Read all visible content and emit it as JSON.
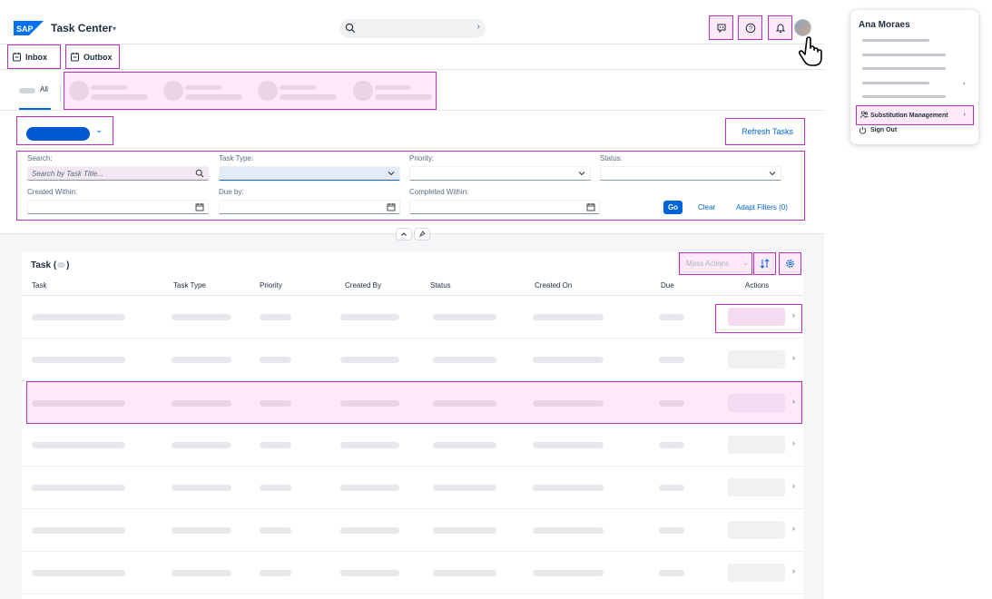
{
  "shell": {
    "logo_text": "SAP",
    "title": "Task Center",
    "search_placeholder": "",
    "brand_color": "#0064d9"
  },
  "subnav": {
    "inbox": "Inbox",
    "outbox": "Outbox"
  },
  "tabs": {
    "all": "All"
  },
  "filters": {
    "refresh": "Refresh Tasks",
    "search_label": "Search:",
    "search_placeholder": "Search by Task Title...",
    "task_type_label": "Task Type:",
    "priority_label": "Priority:",
    "status_label": "Status:",
    "created_within_label": "Created Within:",
    "due_by_label": "Due by:",
    "completed_within_label": "Completed Within:",
    "go": "Go",
    "clear": "Clear",
    "adapt": "Adapt Filters (0)"
  },
  "table": {
    "title_prefix": "Task (",
    "title_suffix": ")",
    "mass_actions": "Mass Actions",
    "columns": [
      "Task",
      "Task Type",
      "Priority",
      "Created By",
      "Status",
      "Created On",
      "Due",
      "Actions"
    ],
    "rows_count_visible": 7
  },
  "user_menu": {
    "name": "Ana Moraes",
    "substitution": "Substitution Management",
    "sign_out": "Sign Out"
  },
  "colors": {
    "highlight_border": "#b82fb8",
    "highlight_fill": "#fde9fa",
    "link": "#0064d9"
  }
}
